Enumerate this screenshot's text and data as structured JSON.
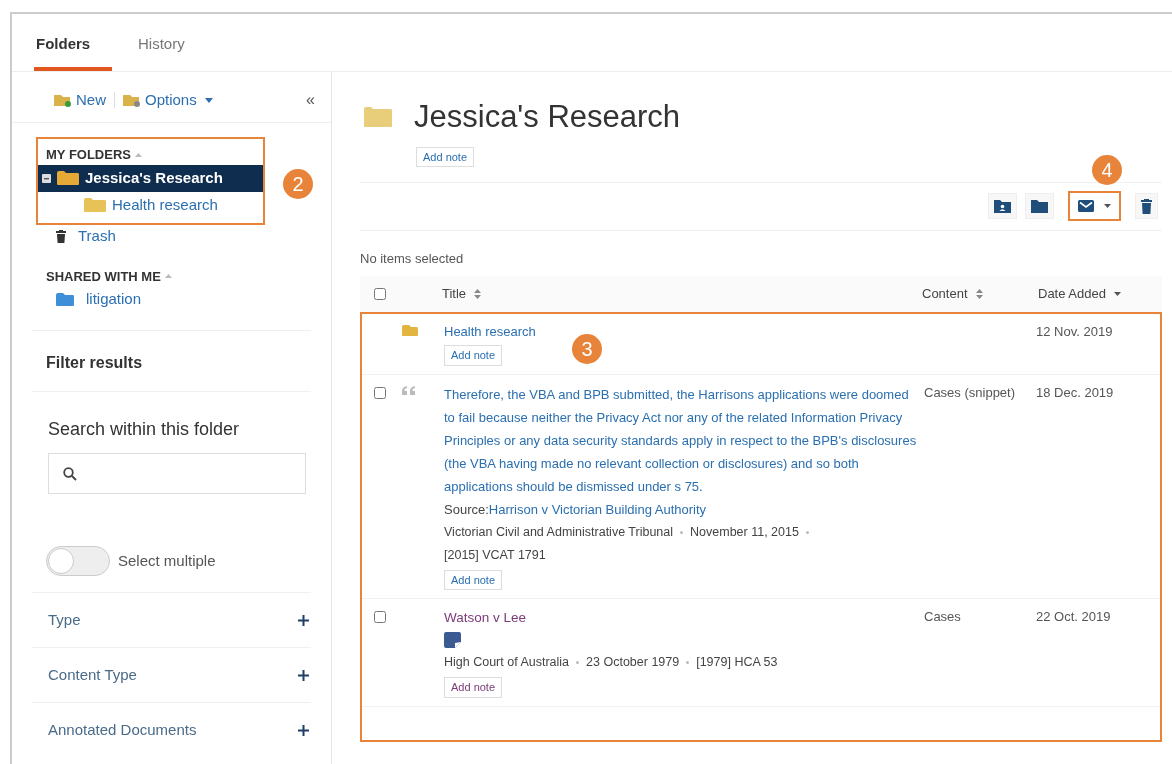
{
  "tabs": [
    {
      "label": "Folders",
      "selected": true
    },
    {
      "label": "History",
      "selected": false
    }
  ],
  "sidebar": {
    "toolbar": [
      {
        "label": "New",
        "kind": "new"
      },
      {
        "label": "Options",
        "kind": "options"
      }
    ],
    "my_folders": {
      "heading": "MY FOLDERS",
      "items": [
        {
          "label": "Jessica's Research",
          "selected": true,
          "expanded": true,
          "children": [
            {
              "label": "Health research",
              "selected": false
            }
          ]
        }
      ]
    },
    "collapse": "«",
    "trash": "Trash",
    "shared": {
      "heading": "SHARED WITH ME",
      "items": [
        {
          "label": "litigation",
          "selected": false
        }
      ]
    },
    "filter_title": "Filter results",
    "search_title": "Search within this folder",
    "select_multiple": {
      "label": "Select multiple",
      "on": false
    },
    "filters": [
      "Type",
      "Content Type",
      "Annotated Documents"
    ]
  },
  "main": {
    "title": "Jessica's Research",
    "add_note": "Add note",
    "selection_status": "No items selected",
    "select_all_checked": false,
    "columns": [
      "Title",
      "Content",
      "Date Added"
    ],
    "rows": [
      {
        "kind": "folder",
        "title": "Health research",
        "note_button": "Add note",
        "content": "",
        "date": "12 Nov. 2019"
      },
      {
        "kind": "snippet",
        "title": "Therefore, the VBA and BPB submitted, the Harrisons applications were doomed to fail because neither the Privacy Act nor any of the related Information Privacy Principles or any data security standards apply in respect to the BPB's disclosures (the VBA having made no relevant collection or disclosures) and so both applications should be dismissed under s 75.",
        "source_label": "Source:",
        "source": "Harrison v Victorian Building Authority",
        "meta": [
          "Victorian Civil and Administrative Tribunal",
          "November 11, 2015",
          "[2015] VCAT 1791"
        ],
        "note_button": "Add note",
        "content": "Cases (snippet)",
        "date": "18 Dec. 2019",
        "checked": false
      },
      {
        "kind": "case",
        "title": "Watson v Lee",
        "has_note": true,
        "meta": [
          "High Court of Australia",
          "23 October 1979",
          "[1979] HCA 53"
        ],
        "note_button": "Add note",
        "content": "Cases",
        "date": "22 Oct. 2019",
        "checked": false
      }
    ]
  },
  "callouts": [
    "2",
    "3",
    "4"
  ]
}
